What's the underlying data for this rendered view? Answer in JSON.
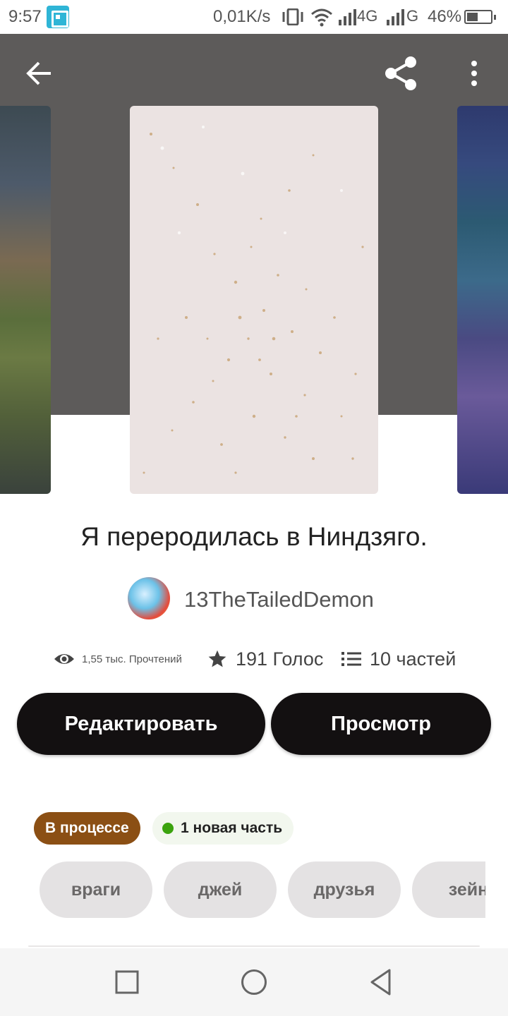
{
  "status_bar": {
    "time": "9:57",
    "net_speed": "0,01K/s",
    "network_1": "4G",
    "network_2": "G",
    "battery_percent": "46%",
    "battery_level": 0.46
  },
  "header": {
    "back_icon": "arrow-left-icon",
    "share_icon": "share-icon",
    "more_icon": "more-vertical-icon"
  },
  "story": {
    "title": "Я переродилась в Ниндзяго.",
    "author": "13TheTailedDemon"
  },
  "stats": {
    "reads": "1,55 тыс. Прочтений",
    "votes": "191 Голос",
    "parts": "10 частей"
  },
  "actions": {
    "edit_label": "Редактировать",
    "view_label": "Просмотр"
  },
  "badges": {
    "status": "В процессе",
    "new_part": "1 новая часть"
  },
  "tags": [
    "враги",
    "джей",
    "друзья",
    "зейн"
  ],
  "colors": {
    "header_bg": "#5d5b5a",
    "button_bg": "#131011",
    "status_badge": "#8b4f14",
    "new_dot": "#3ba30e",
    "tag_bg": "#e4e2e3"
  }
}
